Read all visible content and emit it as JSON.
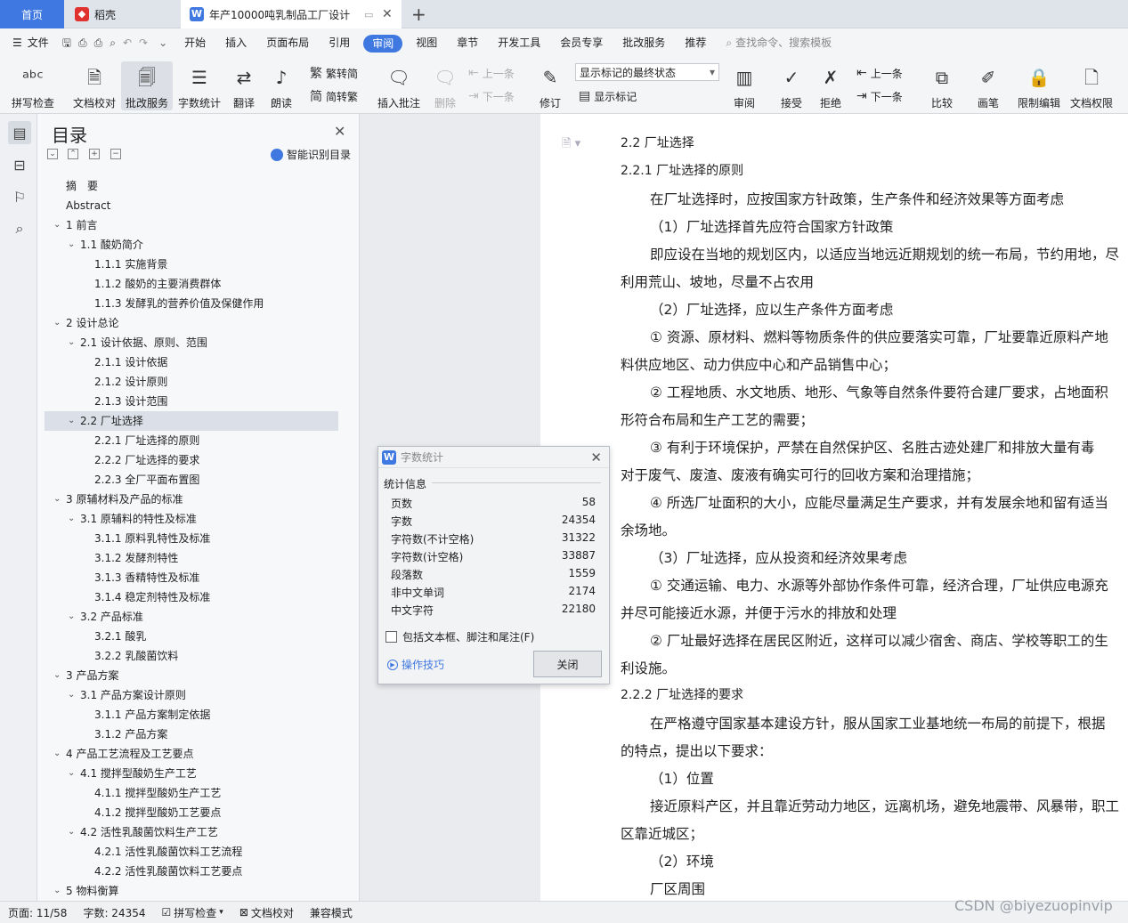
{
  "tabs": {
    "home": "首页",
    "daoke": "稻壳",
    "doc": "年产10000吨乳制品工厂设计"
  },
  "menu": {
    "file": "文件",
    "items": [
      "开始",
      "插入",
      "页面布局",
      "引用",
      "审阅",
      "视图",
      "章节",
      "开发工具",
      "会员专享",
      "批改服务",
      "推荐"
    ],
    "search": "查找命令、搜索模板"
  },
  "ribbon": {
    "spell": "拼写检查",
    "proof": "文档校对",
    "review_service": "批改服务",
    "wordcount": "字数统计",
    "translate": "翻译",
    "read": "朗读",
    "to_trad": "繁转简",
    "to_simp": "简转繁",
    "insert_comment": "插入批注",
    "delete": "删除",
    "prev": "上一条",
    "next": "下一条",
    "track": "修订",
    "markup_state": "显示标记的最终状态",
    "show_markup": "显示标记",
    "review": "审阅",
    "accept": "接受",
    "reject": "拒绝",
    "prev2": "上一条",
    "next2": "下一条",
    "compare": "比较",
    "pen": "画笔",
    "restrict": "限制编辑",
    "perm": "文档权限"
  },
  "toc": {
    "title": "目录",
    "smart": "智能识别目录",
    "items": [
      {
        "text": "摘　要",
        "level": 0,
        "chev": false
      },
      {
        "text": "Abstract",
        "level": 0,
        "chev": false
      },
      {
        "text": "1  前言",
        "level": 0,
        "chev": true
      },
      {
        "text": "1.1  酸奶简介",
        "level": 1,
        "chev": true
      },
      {
        "text": "1.1.1  实施背景",
        "level": 2,
        "chev": false
      },
      {
        "text": "1.1.2  酸奶的主要消费群体",
        "level": 2,
        "chev": false
      },
      {
        "text": "1.1.3  发酵乳的营养价值及保健作用",
        "level": 2,
        "chev": false
      },
      {
        "text": "2  设计总论",
        "level": 0,
        "chev": true
      },
      {
        "text": "2.1  设计依据、原则、范围",
        "level": 1,
        "chev": true
      },
      {
        "text": "2.1.1  设计依据",
        "level": 2,
        "chev": false
      },
      {
        "text": "2.1.2  设计原则",
        "level": 2,
        "chev": false
      },
      {
        "text": "2.1.3  设计范围",
        "level": 2,
        "chev": false
      },
      {
        "text": "2.2  厂址选择",
        "level": 1,
        "chev": true,
        "sel": true
      },
      {
        "text": "2.2.1  厂址选择的原则",
        "level": 2,
        "chev": false
      },
      {
        "text": "2.2.2  厂址选择的要求",
        "level": 2,
        "chev": false
      },
      {
        "text": "2.2.3  全厂平面布置图",
        "level": 2,
        "chev": false
      },
      {
        "text": "3  原辅材料及产品的标准",
        "level": 0,
        "chev": true
      },
      {
        "text": "3.1  原辅料的特性及标准",
        "level": 1,
        "chev": true
      },
      {
        "text": "3.1.1  原料乳特性及标准",
        "level": 2,
        "chev": false
      },
      {
        "text": "3.1.2  发酵剂特性",
        "level": 2,
        "chev": false
      },
      {
        "text": "3.1.3  香精特性及标准",
        "level": 2,
        "chev": false
      },
      {
        "text": "3.1.4  稳定剂特性及标准",
        "level": 2,
        "chev": false
      },
      {
        "text": "3.2  产品标准",
        "level": 1,
        "chev": true
      },
      {
        "text": "3.2.1  酸乳",
        "level": 2,
        "chev": false
      },
      {
        "text": "3.2.2  乳酸菌饮料",
        "level": 2,
        "chev": false
      },
      {
        "text": "3  产品方案",
        "level": 0,
        "chev": true
      },
      {
        "text": "3.1  产品方案设计原则",
        "level": 1,
        "chev": true
      },
      {
        "text": "3.1.1  产品方案制定依据",
        "level": 2,
        "chev": false
      },
      {
        "text": "3.1.2  产品方案",
        "level": 2,
        "chev": false
      },
      {
        "text": "4  产品工艺流程及工艺要点",
        "level": 0,
        "chev": true
      },
      {
        "text": "4.1  搅拌型酸奶生产工艺",
        "level": 1,
        "chev": true
      },
      {
        "text": "4.1.1  搅拌型酸奶生产工艺",
        "level": 2,
        "chev": false
      },
      {
        "text": "4.1.2  搅拌型酸奶工艺要点",
        "level": 2,
        "chev": false
      },
      {
        "text": "4.2  活性乳酸菌饮料生产工艺",
        "level": 1,
        "chev": true
      },
      {
        "text": "4.2.1  活性乳酸菌饮料工艺流程",
        "level": 2,
        "chev": false
      },
      {
        "text": "4.2.2  活性乳酸菌饮料工艺要点",
        "level": 2,
        "chev": false
      },
      {
        "text": "5  物料衡算",
        "level": 0,
        "chev": true
      }
    ]
  },
  "doc_lines": [
    {
      "text": "2.2  厂址选择",
      "style": "h"
    },
    {
      "text": "2.2.1  厂址选择的原则",
      "style": "h"
    },
    {
      "text": "在厂址选择时，应按国家方针政策，生产条件和经济效果等方面考虑",
      "style": "ind"
    },
    {
      "text": "（1）厂址选择首先应符合国家方针政策",
      "style": "ind"
    },
    {
      "text": "即应设在当地的规划区内，以适应当地远近期规划的统一布局，节约用地，尽",
      "style": "ind"
    },
    {
      "text": "利用荒山、坡地，尽量不占农用",
      "style": ""
    },
    {
      "text": "（2）厂址选择，应以生产条件方面考虑",
      "style": "ind"
    },
    {
      "text": "① 资源、原材料、燃料等物质条件的供应要落实可靠，厂址要靠近原料产地",
      "style": "ind"
    },
    {
      "text": "料供应地区、动力供应中心和产品销售中心；",
      "style": ""
    },
    {
      "text": "② 工程地质、水文地质、地形、气象等自然条件要符合建厂要求，占地面积",
      "style": "ind"
    },
    {
      "text": "形符合布局和生产工艺的需要；",
      "style": ""
    },
    {
      "text": "③ 有利于环境保护，严禁在自然保护区、名胜古迹处建厂和排放大量有毒",
      "style": "ind"
    },
    {
      "text": "对于废气、废渣、废液有确实可行的回收方案和治理措施；",
      "style": ""
    },
    {
      "text": "④ 所选厂址面积的大小，应能尽量满足生产要求，并有发展余地和留有适当",
      "style": "ind"
    },
    {
      "text": "余场地。",
      "style": ""
    },
    {
      "text": "（3）厂址选择，应从投资和经济效果考虑",
      "style": "ind"
    },
    {
      "text": "① 交通运输、电力、水源等外部协作条件可靠，经济合理，厂址供应电源充",
      "style": "ind"
    },
    {
      "text": "并尽可能接近水源，并便于污水的排放和处理",
      "style": ""
    },
    {
      "text": "② 厂址最好选择在居民区附近，这样可以减少宿舍、商店、学校等职工的生",
      "style": "ind"
    },
    {
      "text": "利设施。",
      "style": ""
    },
    {
      "text": "2.2.2  厂址选择的要求",
      "style": "h"
    },
    {
      "text": "在严格遵守国家基本建设方针，服从国家工业基地统一布局的前提下，根据",
      "style": "ind"
    },
    {
      "text": "的特点，提出以下要求：",
      "style": ""
    },
    {
      "text": "（1）位置",
      "style": "ind"
    },
    {
      "text": "接近原料产区，并且靠近劳动力地区，远离机场，避免地震带、风暴带，职工",
      "style": "ind"
    },
    {
      "text": "区靠近城区；",
      "style": ""
    },
    {
      "text": "（2）环境",
      "style": "ind"
    },
    {
      "text": "厂区周围",
      "style": "ind"
    }
  ],
  "dialog": {
    "title": "字数统计",
    "section": "统计信息",
    "stats": [
      {
        "label": "页数",
        "value": "58"
      },
      {
        "label": "字数",
        "value": "24354"
      },
      {
        "label": "字符数(不计空格)",
        "value": "31322"
      },
      {
        "label": "字符数(计空格)",
        "value": "33887"
      },
      {
        "label": "段落数",
        "value": "1559"
      },
      {
        "label": "非中文单词",
        "value": "2174"
      },
      {
        "label": "中文字符",
        "value": "22180"
      }
    ],
    "checkbox": "包括文本框、脚注和尾注(F)",
    "tips": "操作技巧",
    "close": "关闭"
  },
  "status": {
    "page": "页面: 11/58",
    "words": "字数: 24354",
    "spell": "拼写检查",
    "proof": "文档校对",
    "compat": "兼容模式"
  },
  "watermark": "CSDN @biyezuopinvip",
  "colors": {
    "accent": "#3f78e0",
    "daoke_red": "#e0322f"
  }
}
